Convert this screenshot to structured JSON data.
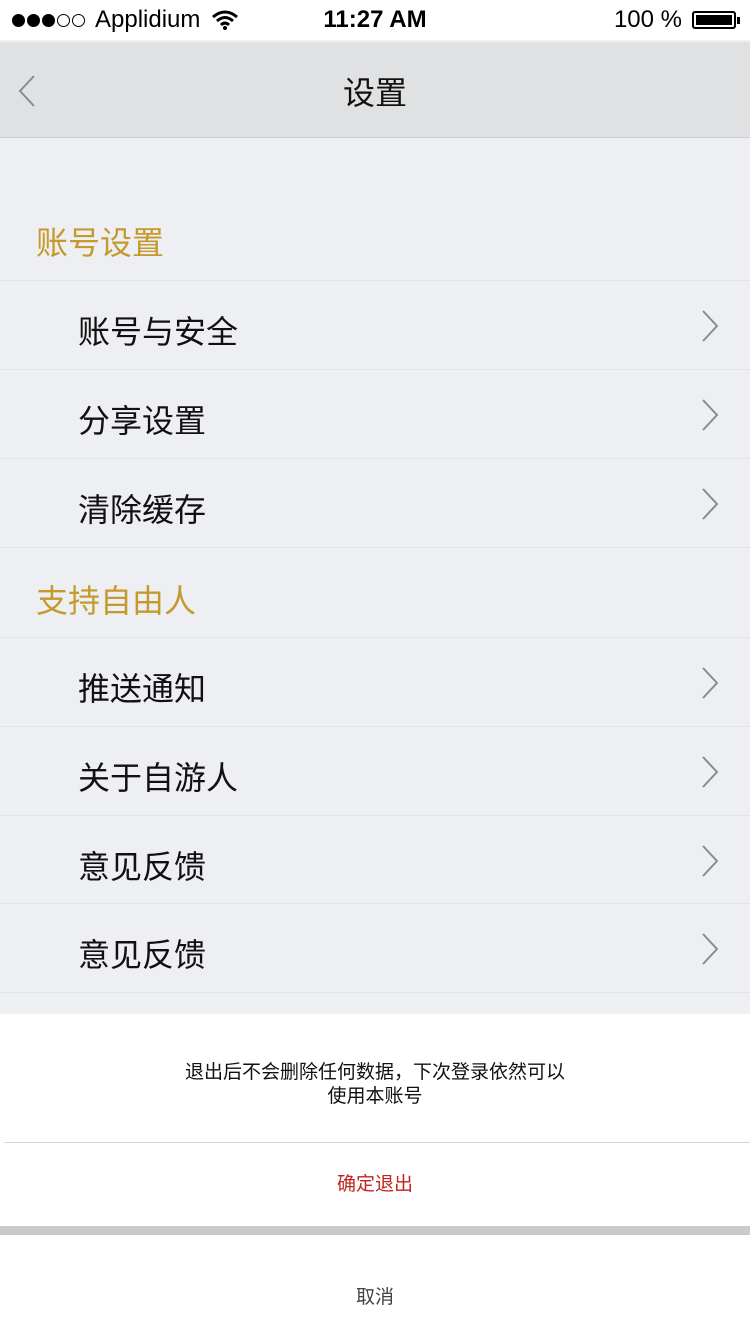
{
  "status_bar": {
    "signal_dots_filled": 3,
    "signal_dots_total": 5,
    "carrier": "Applidium",
    "time": "11:27 AM",
    "battery_text": "100 %",
    "battery_level": 1.0,
    "wifi_icon": "wifi-icon"
  },
  "nav": {
    "title": "设置",
    "back_icon": "chevron-left-icon"
  },
  "sections": [
    {
      "header": "账号设置",
      "items": [
        {
          "label": "账号与安全"
        },
        {
          "label": "分享设置"
        },
        {
          "label": "清除缓存"
        }
      ]
    },
    {
      "header": "支持自由人",
      "items": [
        {
          "label": "推送通知"
        },
        {
          "label": "关于自游人"
        },
        {
          "label": "意见反馈"
        },
        {
          "label": "意见反馈"
        }
      ]
    }
  ],
  "action_sheet": {
    "message_line1": "退出后不会删除任何数据，下次登录依然可以",
    "message_line2": "使用本账号",
    "confirm_label": "确定退出",
    "cancel_label": "取消"
  },
  "colors": {
    "section_header": "#c49a2c",
    "confirm": "#c0271c",
    "background": "#eeeff3",
    "nav_background": "#e0e1e3"
  }
}
